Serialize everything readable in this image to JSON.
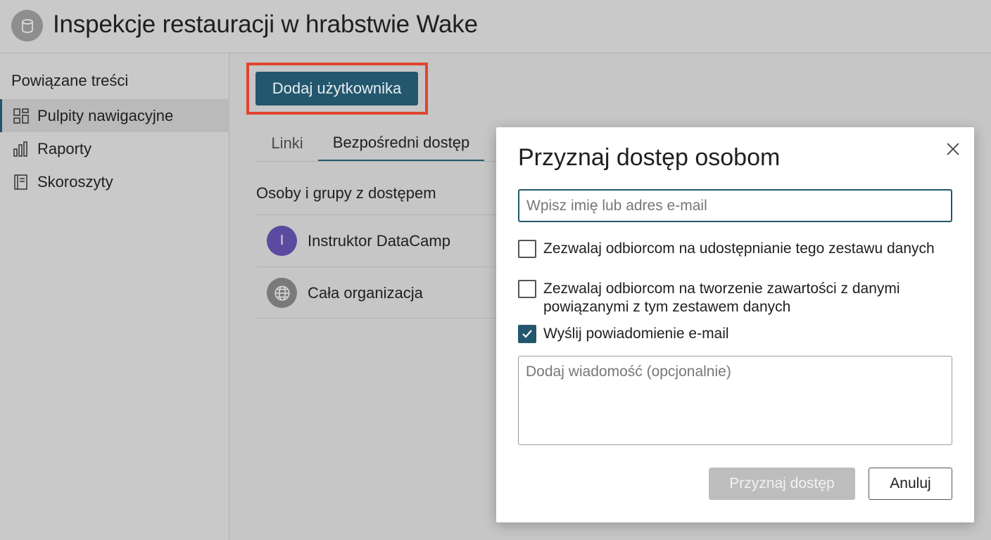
{
  "header": {
    "title": "Inspekcje restauracji w hrabstwie Wake",
    "icon": "database-icon"
  },
  "sidebar": {
    "heading": "Powiązane treści",
    "items": [
      {
        "label": "Pulpity nawigacyjne",
        "icon": "dashboard-icon",
        "active": true
      },
      {
        "label": "Raporty",
        "icon": "bar-chart-icon",
        "active": false
      },
      {
        "label": "Skoroszyty",
        "icon": "notebook-icon",
        "active": false
      }
    ]
  },
  "main": {
    "add_user_label": "Dodaj użytkownika",
    "tabs": [
      {
        "label": "Linki",
        "active": false
      },
      {
        "label": "Bezpośredni dostęp",
        "active": true
      }
    ],
    "section_title": "Osoby i grupy z dostępem",
    "access_list": [
      {
        "name": "Instruktor DataCamp",
        "avatar_letter": "I",
        "avatar_color": "#5a4aa0"
      },
      {
        "name": "Cała organizacja",
        "icon": "globe-icon",
        "avatar_color": "#7a7a7a"
      }
    ]
  },
  "dialog": {
    "title": "Przyznaj dostęp osobom",
    "email_placeholder": "Wpisz imię lub adres e-mail",
    "options": [
      {
        "label": "Zezwalaj odbiorcom na udostępnianie tego zestawu danych",
        "checked": false
      },
      {
        "label": "Zezwalaj odbiorcom na tworzenie zawartości z danymi powiązanymi z tym zestawem danych",
        "checked": false
      },
      {
        "label": "Wyślij powiadomienie e-mail",
        "checked": true
      }
    ],
    "message_placeholder": "Dodaj wiadomość (opcjonalnie)",
    "grant_label": "Przyznaj dostęp",
    "cancel_label": "Anuluj"
  },
  "colors": {
    "accent": "#23576d",
    "highlight": "#e0442f"
  }
}
